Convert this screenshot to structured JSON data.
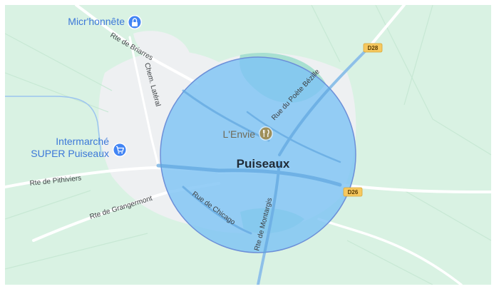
{
  "map": {
    "town_label": "Puiseaux",
    "route_shields": [
      {
        "label": "D28"
      },
      {
        "label": "D26"
      }
    ],
    "road_labels": {
      "rte_de_briarres": "Rte de Briarres",
      "chem_lateral": "Chem. Latéral",
      "rue_du_poete_bezille": "Rue du Poète Bézille",
      "rte_de_pithiviers": "Rte de Pithiviers",
      "rte_de_grangermont": "Rte de Grangermont",
      "rue_de_chicago": "Rue de Chicago",
      "rte_de_montargis": "Rte de Montargis"
    },
    "pois": {
      "micr_honnete": {
        "name": "Micr'honnête",
        "icon": "lock-icon",
        "color": "#4285f4"
      },
      "lenvie": {
        "name": "L'Envie",
        "icon": "restaurant-icon",
        "color": "#9e8f5a"
      },
      "intermarche": {
        "name_line1": "Intermarché",
        "name_line2": "SUPER Puiseaux",
        "icon": "shopping-cart-icon",
        "color": "#4285f4"
      }
    },
    "colors": {
      "land": "#d9f2e3",
      "town_area": "#eef0f2",
      "water_patch": "#a8e0d1",
      "road": "#ffffff",
      "radius_fill": "#7fc3f4",
      "radius_stroke": "#6c8fd8",
      "shield": "#f6c85f"
    }
  }
}
